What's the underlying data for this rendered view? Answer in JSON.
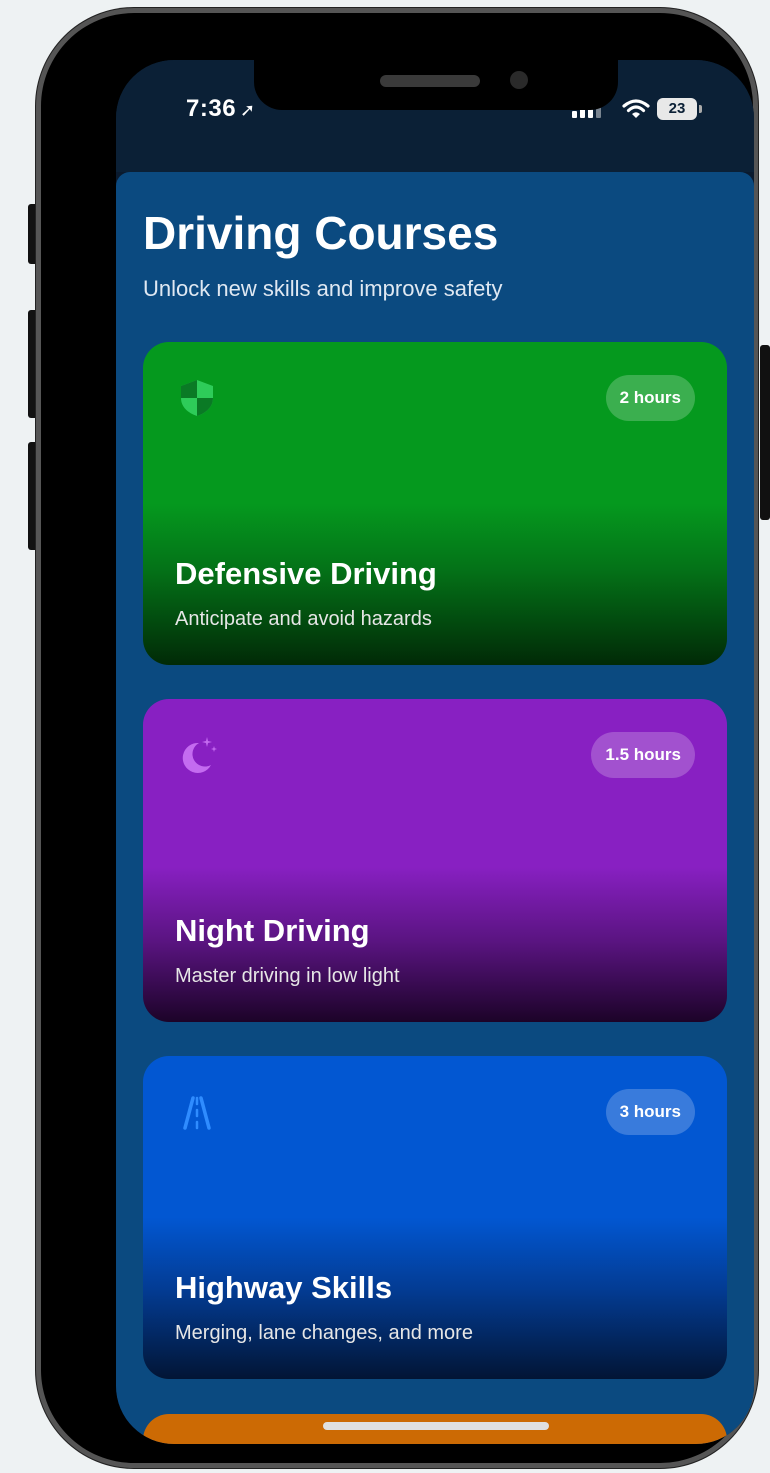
{
  "status_bar": {
    "time": "7:36",
    "battery": "23"
  },
  "header": {
    "title": "Driving Courses",
    "subtitle": "Unlock new skills and improve safety"
  },
  "courses": [
    {
      "title": "Defensive Driving",
      "description": "Anticipate and avoid hazards",
      "duration": "2 hours",
      "icon": "shield-icon",
      "color": "#05991e"
    },
    {
      "title": "Night Driving",
      "description": "Master driving in low light",
      "duration": "1.5 hours",
      "icon": "moon-stars-icon",
      "color": "#8820c2"
    },
    {
      "title": "Highway Skills",
      "description": "Merging, lane changes, and more",
      "duration": "3 hours",
      "icon": "road-icon",
      "color": "#0257d2"
    }
  ],
  "peek_card_color": "#cc6a04"
}
